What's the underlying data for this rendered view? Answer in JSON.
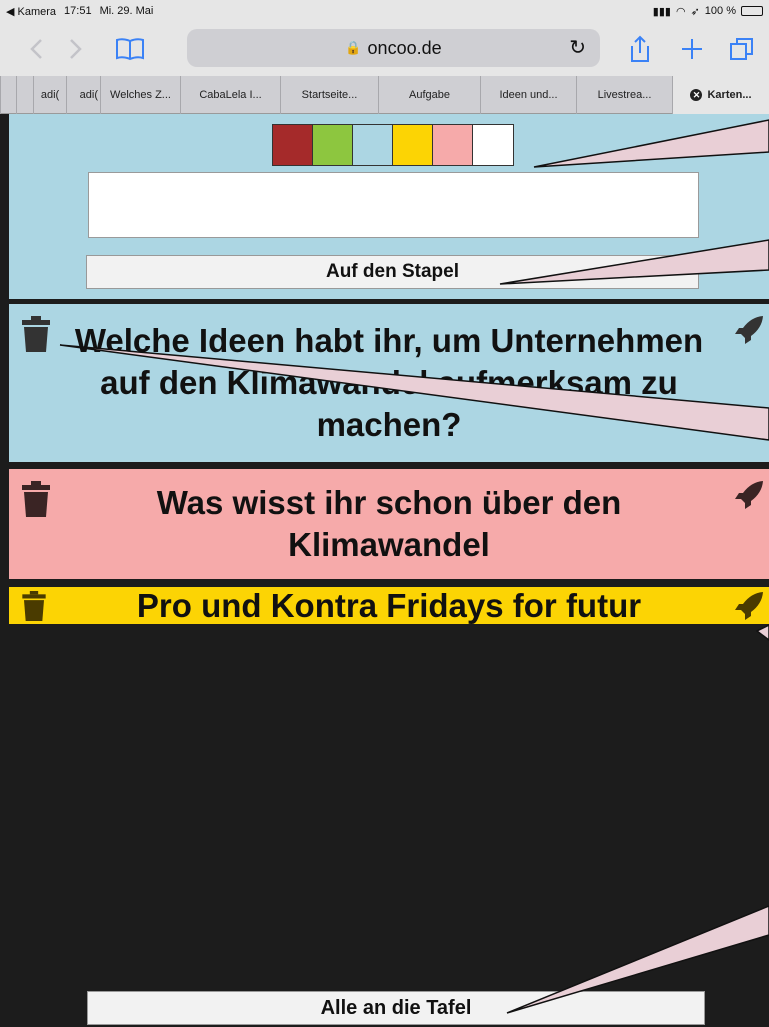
{
  "status_bar": {
    "back_app": "◀ Kamera",
    "time": "17:51",
    "date": "Mi. 29. Mai",
    "battery": "100 %",
    "battery_level": 1.0
  },
  "browser": {
    "url": "oncoo.de",
    "icons": [
      "back-icon",
      "forward-icon",
      "bookmarks-icon",
      "lock-icon",
      "reload-icon",
      "share-icon",
      "new-tab-icon",
      "tabs-icon"
    ]
  },
  "tabs": [
    {
      "label": ""
    },
    {
      "label": ""
    },
    {
      "label": "adi("
    },
    {
      "label": "Welches Z..."
    },
    {
      "label": "CabaLela I..."
    },
    {
      "label": "Startseite..."
    },
    {
      "label": "Aufgabe"
    },
    {
      "label": "Ideen und..."
    },
    {
      "label": "Livestrea..."
    },
    {
      "label": "Karten...",
      "active": true
    }
  ],
  "input_panel": {
    "colors": [
      "#a52a2a",
      "#8dc63f",
      "#acd6e3",
      "#fcd404",
      "#f6aaaa",
      "#ffffff"
    ],
    "text_value": "",
    "stack_button": "Auf den Stapel"
  },
  "cards": [
    {
      "text": "Welche Ideen habt ihr, um Unternehmen auf den Klimawandel aufmerksam zu machen?",
      "color": "#acd6e3"
    },
    {
      "text": "Was wisst ihr schon über den Klimawandel",
      "color": "#f6aaaa"
    },
    {
      "text": "Pro und Kontra Fridays for futur",
      "color": "#fcd404"
    }
  ],
  "board_button": "Alle an die Tafel"
}
